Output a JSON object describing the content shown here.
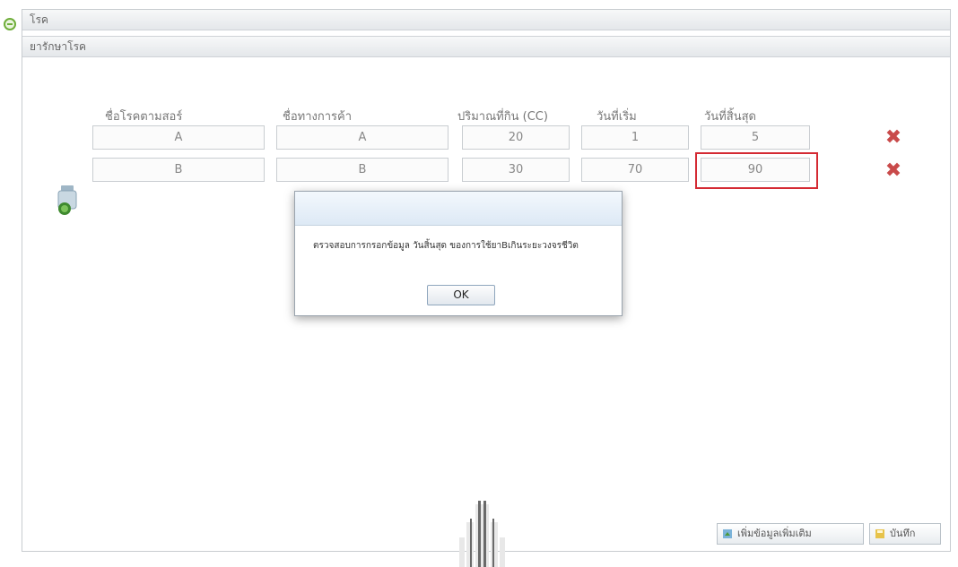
{
  "panel": {
    "section_title": "โรค",
    "subsection_title": "ยารักษาโรค"
  },
  "table": {
    "headers": [
      "ชื่อโรคตามสอร์",
      "ชื่อทางการค้า",
      "ปริมาณที่กิน (CC)",
      "วันที่เริ่ม",
      "วันที่สิ้นสุด"
    ],
    "rows": [
      [
        "A",
        "A",
        "20",
        "1",
        "5"
      ],
      [
        "B",
        "B",
        "30",
        "70",
        "90"
      ]
    ]
  },
  "dialog": {
    "title": "",
    "message": "ตรวจสอบการกรอกข้อมูล วันสิ้นสุด ของการใช้ยาBเกินระยะวงจรชีวิต",
    "ok_label": "OK"
  },
  "footer": {
    "add_button_label": "เพิ่มข้อมูลเพิ่มเติม",
    "save_button_label": "บันทึก"
  },
  "colors": {
    "highlight": "#d42a33",
    "delete": "#c94a4a"
  },
  "icons": {
    "status": "green-circle-icon",
    "delete": "red-x-icon",
    "side": "medicine-bottle-icon",
    "add": "add-icon",
    "save": "save-icon",
    "watermark": "university-logo"
  }
}
